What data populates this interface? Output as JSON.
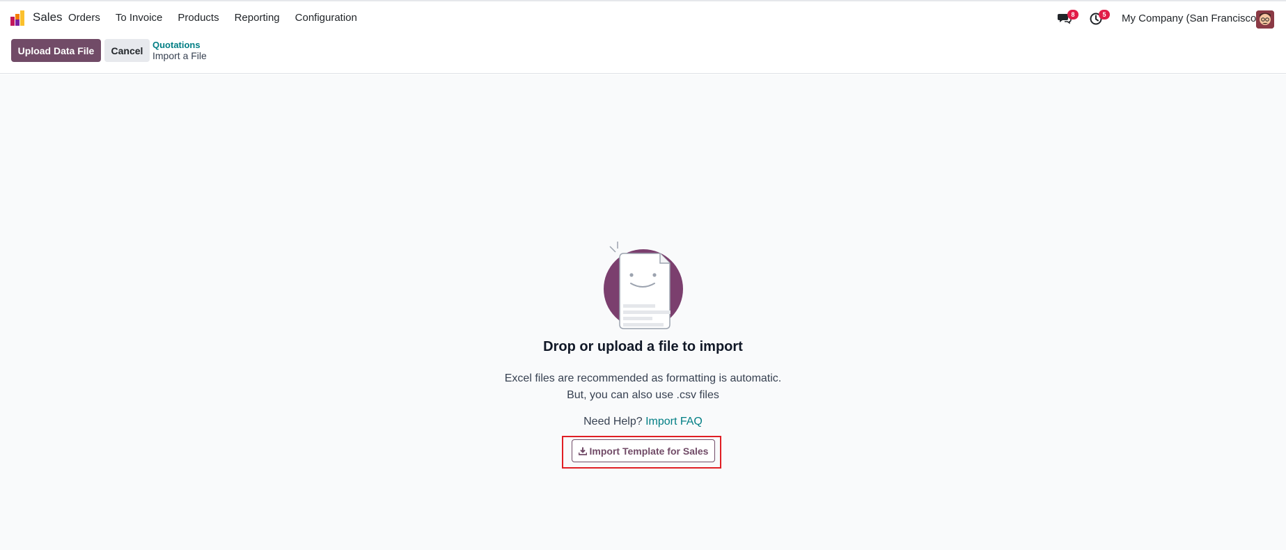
{
  "navbar": {
    "app_name": "Sales",
    "menu": [
      "Orders",
      "To Invoice",
      "Products",
      "Reporting",
      "Configuration"
    ],
    "messages_count": "8",
    "activities_count": "5",
    "company": "My Company (San Francisco)"
  },
  "control_panel": {
    "upload_label": "Upload Data File",
    "cancel_label": "Cancel",
    "breadcrumb_parent": "Quotations",
    "breadcrumb_current": "Import a File"
  },
  "empty_state": {
    "title": "Drop or upload a file to import",
    "desc_line1": "Excel files are recommended as formatting is automatic.",
    "desc_line2": "But, you can also use .csv files",
    "help_prefix": "Need Help?",
    "help_link": "Import FAQ",
    "template_button": "Import Template for Sales"
  },
  "colors": {
    "brand": "#714b67",
    "link": "#017e84",
    "highlight": "#e01e24",
    "badge": "#e11d48"
  },
  "icons": [
    "app-logo-icon",
    "chat-icon",
    "clock-icon",
    "download-icon",
    "file-smiley-icon"
  ]
}
